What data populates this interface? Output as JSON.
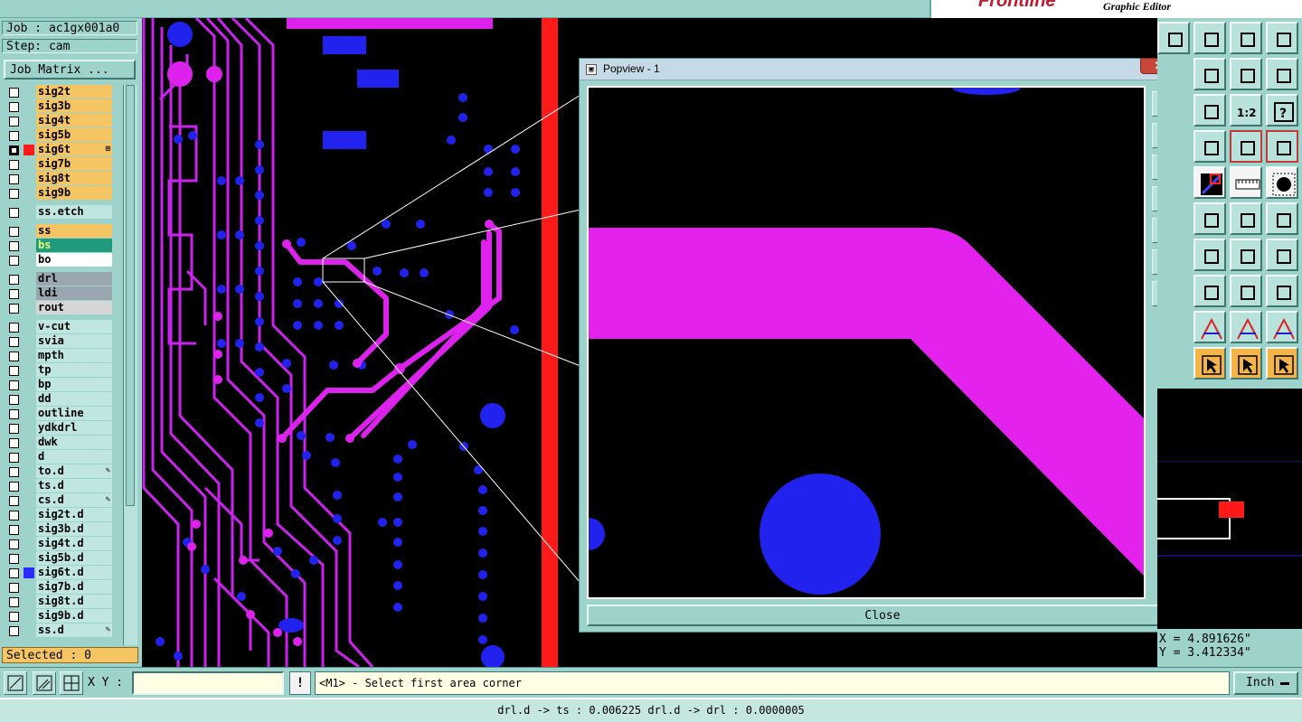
{
  "brand": {
    "logo": "Frontline",
    "subtitle": "Graphic Editor"
  },
  "job": {
    "job_label": "Job : ac1gx001a0",
    "step_label": "Step: cam",
    "matrix_button": "Job Matrix ..."
  },
  "layers": [
    {
      "name": "sig2t",
      "bg": "#f5c564",
      "checked": false,
      "swatch": ""
    },
    {
      "name": "sig3b",
      "bg": "#f5c564",
      "checked": false,
      "swatch": ""
    },
    {
      "name": "sig4t",
      "bg": "#f5c564",
      "checked": false,
      "swatch": ""
    },
    {
      "name": "sig5b",
      "bg": "#f5c564",
      "checked": false,
      "swatch": ""
    },
    {
      "name": "sig6t",
      "bg": "#f5c564",
      "checked": true,
      "swatch": "#ff1a1a",
      "mark": "⊞"
    },
    {
      "name": "sig7b",
      "bg": "#f5c564",
      "checked": false,
      "swatch": ""
    },
    {
      "name": "sig8t",
      "bg": "#f5c564",
      "checked": false,
      "swatch": ""
    },
    {
      "name": "sig9b",
      "bg": "#f5c564",
      "checked": false,
      "swatch": ""
    },
    {
      "name": "ss.etch",
      "bg": "#bfe6e0",
      "checked": false,
      "swatch": "",
      "gap": true
    },
    {
      "name": "ss",
      "bg": "#f5c564",
      "checked": false,
      "swatch": "",
      "gap": true
    },
    {
      "name": "bs",
      "bg": "#1f9a7a",
      "checked": false,
      "swatch": ""
    },
    {
      "name": "bo",
      "bg": "#ffffff",
      "checked": false,
      "swatch": ""
    },
    {
      "name": "drl",
      "bg": "#9aa6b0",
      "checked": false,
      "swatch": "",
      "gap": true
    },
    {
      "name": "ldi",
      "bg": "#9aa6b0",
      "checked": false,
      "swatch": ""
    },
    {
      "name": "rout",
      "bg": "#d6d6d6",
      "checked": false,
      "swatch": ""
    },
    {
      "name": "v-cut",
      "bg": "#bfe6e0",
      "checked": false,
      "swatch": "",
      "gap": true
    },
    {
      "name": "svia",
      "bg": "#bfe6e0",
      "checked": false,
      "swatch": ""
    },
    {
      "name": "mpth",
      "bg": "#bfe6e0",
      "checked": false,
      "swatch": ""
    },
    {
      "name": "tp",
      "bg": "#bfe6e0",
      "checked": false,
      "swatch": ""
    },
    {
      "name": "bp",
      "bg": "#bfe6e0",
      "checked": false,
      "swatch": ""
    },
    {
      "name": "dd",
      "bg": "#bfe6e0",
      "checked": false,
      "swatch": ""
    },
    {
      "name": "outline",
      "bg": "#bfe6e0",
      "checked": false,
      "swatch": ""
    },
    {
      "name": "ydkdrl",
      "bg": "#bfe6e0",
      "checked": false,
      "swatch": ""
    },
    {
      "name": "dwk",
      "bg": "#bfe6e0",
      "checked": false,
      "swatch": ""
    },
    {
      "name": "d",
      "bg": "#bfe6e0",
      "checked": false,
      "swatch": ""
    },
    {
      "name": "to.d",
      "bg": "#bfe6e0",
      "checked": false,
      "swatch": "",
      "mark": "✎"
    },
    {
      "name": "ts.d",
      "bg": "#bfe6e0",
      "checked": false,
      "swatch": ""
    },
    {
      "name": "cs.d",
      "bg": "#bfe6e0",
      "checked": false,
      "swatch": "",
      "mark": "✎"
    },
    {
      "name": "sig2t.d",
      "bg": "#bfe6e0",
      "checked": false,
      "swatch": ""
    },
    {
      "name": "sig3b.d",
      "bg": "#bfe6e0",
      "checked": false,
      "swatch": ""
    },
    {
      "name": "sig4t.d",
      "bg": "#bfe6e0",
      "checked": false,
      "swatch": ""
    },
    {
      "name": "sig5b.d",
      "bg": "#bfe6e0",
      "checked": false,
      "swatch": ""
    },
    {
      "name": "sig6t.d",
      "bg": "#bfe6e0",
      "checked": false,
      "swatch": "#2a2aff"
    },
    {
      "name": "sig7b.d",
      "bg": "#bfe6e0",
      "checked": false,
      "swatch": ""
    },
    {
      "name": "sig8t.d",
      "bg": "#bfe6e0",
      "checked": false,
      "swatch": ""
    },
    {
      "name": "sig9b.d",
      "bg": "#bfe6e0",
      "checked": false,
      "swatch": ""
    },
    {
      "name": "ss.d",
      "bg": "#bfe6e0",
      "checked": false,
      "swatch": "",
      "mark": "✎"
    }
  ],
  "selected_label": "Selected : 0",
  "popview": {
    "title": "Popview - 1",
    "close_x": "✕",
    "close_button": "Close"
  },
  "coords": {
    "x": "X = 4.891626\"",
    "y": "Y = 3.412334\""
  },
  "cmd": {
    "xy_label": "X Y :",
    "xy_value": "",
    "bang": "!",
    "prompt": "<M1> - Select first area corner",
    "units": "Inch"
  },
  "status": "drl.d -> ts : 0.006225   drl.d -> drl : 0.0000005",
  "colors": {
    "panel": "#9ed3cc",
    "trace": "#dd22ee",
    "pad": "#2222ee",
    "signal_red": "#ff1a1a"
  }
}
